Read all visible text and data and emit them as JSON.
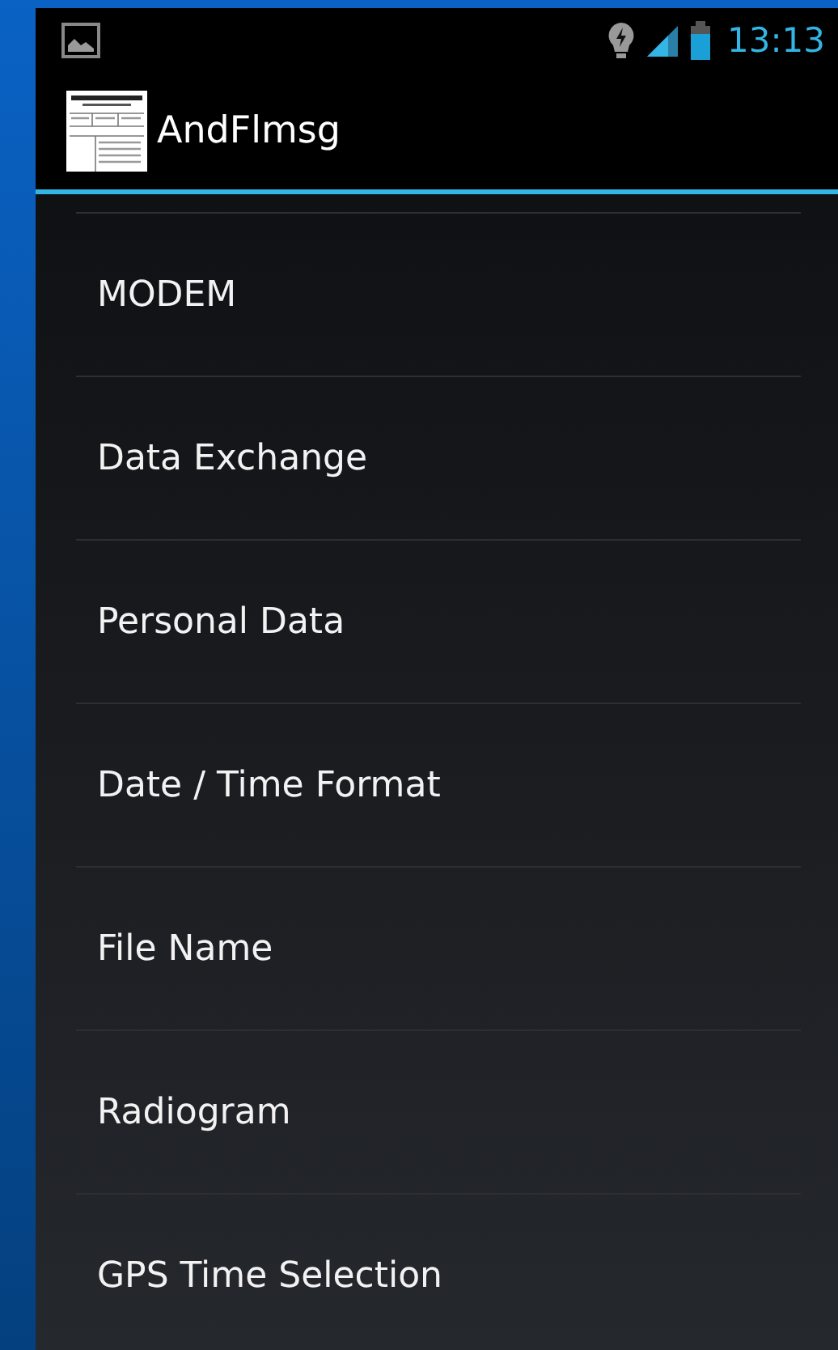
{
  "status_bar": {
    "time": "13:13"
  },
  "action_bar": {
    "title": "AndFlmsg"
  },
  "menu": {
    "items": [
      {
        "label": "MODEM"
      },
      {
        "label": "Data Exchange"
      },
      {
        "label": "Personal Data"
      },
      {
        "label": "Date / Time Format"
      },
      {
        "label": "File Name"
      },
      {
        "label": "Radiogram"
      },
      {
        "label": "GPS Time Selection"
      }
    ]
  }
}
